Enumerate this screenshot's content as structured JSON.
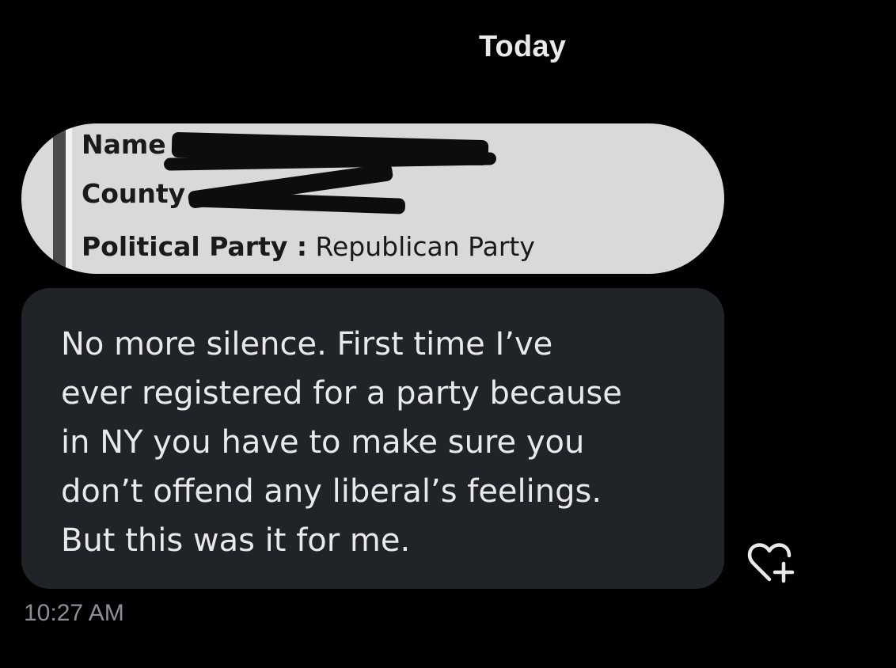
{
  "conversation": {
    "date_header": "Today"
  },
  "image_message": {
    "fields": [
      {
        "label": "Name",
        "separator": ":",
        "value": ""
      },
      {
        "label": "County",
        "separator": ":",
        "value": ""
      },
      {
        "label": "Political Party :",
        "value": "Republican Party"
      }
    ],
    "name_label": "Name",
    "county_label": "County",
    "party_label": "Political Party :",
    "party_value": "Republican Party"
  },
  "text_message": {
    "body": "No more silence. First time I’ve\never registered for a party because\nin NY you have to make sure you\ndon’t offend any liberal’s feelings.\nBut this was it for me.",
    "timestamp": "10:27 AM"
  },
  "icons": {
    "react": "heart-plus-icon"
  },
  "colors": {
    "background": "#000000",
    "bubble": "#202327",
    "text": "#e7e9ea",
    "muted": "#8b9096"
  }
}
